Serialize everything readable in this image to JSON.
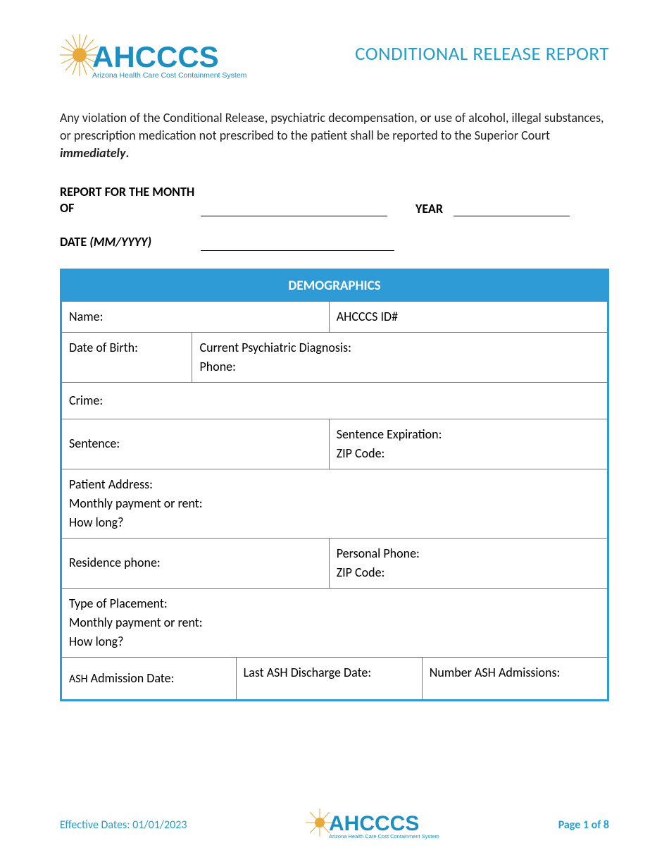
{
  "header": {
    "logo_main": "AHCCCS",
    "logo_sub": "Arizona Health Care Cost Containment System",
    "title": "CONDITIONAL RELEASE REPORT"
  },
  "intro": {
    "text_part1": "Any violation of the Conditional Release, psychiatric decompensation, or use of alcohol, illegal substances, or prescription medication not prescribed to the patient shall be reported to the Superior Court ",
    "text_emph": "immediately",
    "text_period": "."
  },
  "fields": {
    "report_for_label": "REPORT FOR THE MONTH OF",
    "year_label": "YEAR",
    "date_label_part1": "DATE ",
    "date_label_part2": "(MM/YYYY)"
  },
  "demographics": {
    "section_title": "DEMOGRAPHICS",
    "name": "Name:",
    "ahcccs_id": "AHCCCS ID#",
    "dob": "Date of Birth:",
    "diagnosis": "Current Psychiatric Diagnosis:",
    "phone": "Phone:",
    "crime": "Crime:",
    "sentence": "Sentence:",
    "sentence_expiration": "Sentence Expiration:",
    "zip1": "ZIP Code:",
    "patient_address": "Patient Address:",
    "monthly_payment1": "Monthly payment or rent:",
    "how_long1": "How long?",
    "residence_phone": "Residence phone:",
    "personal_phone": "Personal Phone:",
    "zip2": "ZIP Code:",
    "type_placement": "Type of Placement:",
    "monthly_payment2": "Monthly payment or rent:",
    "how_long2": "How long?",
    "ash_admission": "ASH Admission Date:",
    "last_ash_discharge": "Last ASH Discharge Date:",
    "number_ash": "Number ASH Admissions:"
  },
  "footer": {
    "effective": "Effective Dates:  01/01/2023",
    "page": "Page 1 of 8"
  }
}
